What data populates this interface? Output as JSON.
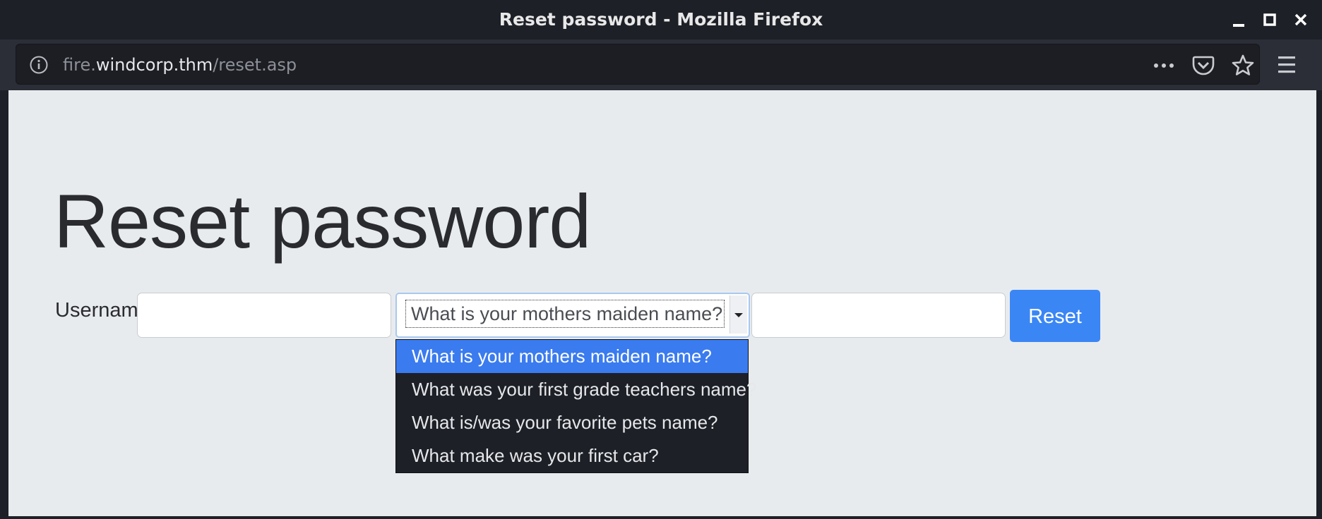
{
  "window": {
    "title": "Reset password - Mozilla Firefox"
  },
  "toolbar": {
    "url_prefix": "fire.",
    "url_domain": "windcorp.thm",
    "url_path": "/reset.asp",
    "icons": [
      "info-icon",
      "more-icon",
      "pocket-icon",
      "star-icon",
      "menu-icon"
    ]
  },
  "page": {
    "heading": "Reset password",
    "username_label": "Username:",
    "username_value": "",
    "answer_value": "",
    "security_question": {
      "selected": "What is your mothers maiden name?",
      "options": [
        "What is your mothers maiden name?",
        "What was your first grade teachers name?",
        "What is/was your favorite pets name?",
        "What make was your first car?"
      ]
    },
    "reset_label": "Reset"
  },
  "colors": {
    "accent": "#3a86f5",
    "dropdown_bg": "#1d2027",
    "page_bg": "#e8ebee"
  }
}
